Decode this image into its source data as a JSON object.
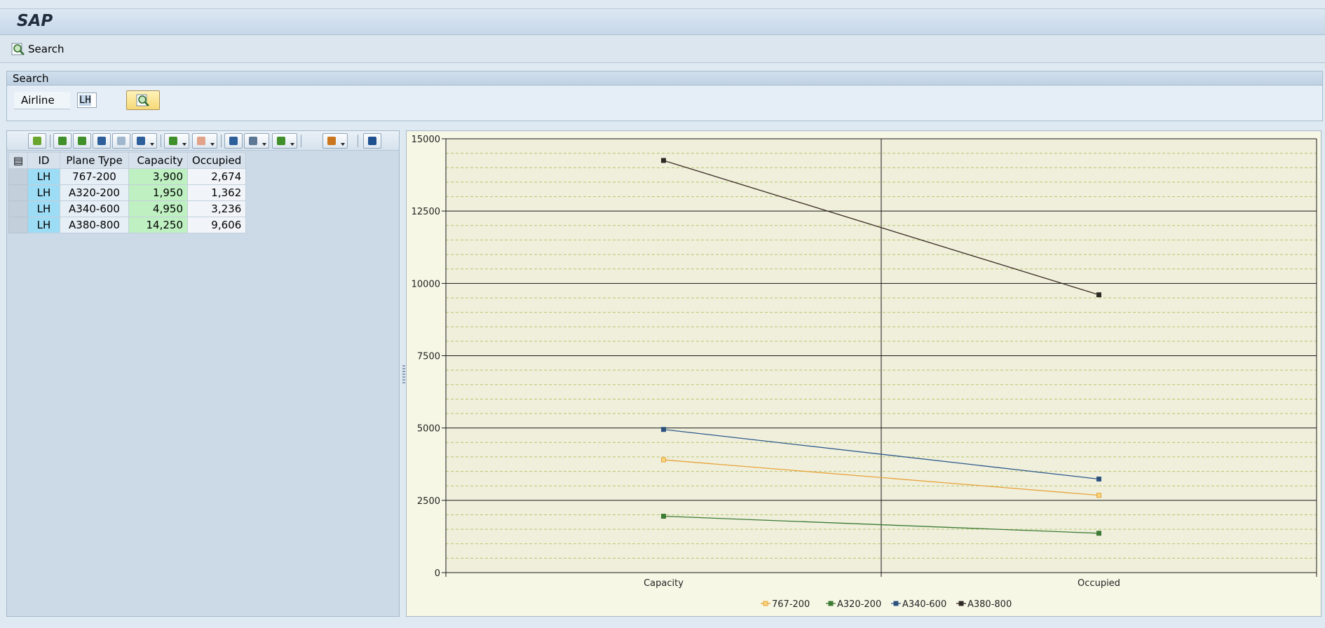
{
  "app": {
    "title": "SAP"
  },
  "toolbar": {
    "search_label": "Search"
  },
  "search_section": {
    "header": "Search",
    "airline_label": "Airline",
    "airline_value": "LH"
  },
  "table": {
    "columns": [
      "ID",
      "Plane Type",
      "Capacity",
      "Occupied"
    ],
    "rows": [
      {
        "id": "LH",
        "plane_type": "767-200",
        "capacity": "3,900",
        "occupied": "2,674"
      },
      {
        "id": "LH",
        "plane_type": "A320-200",
        "capacity": "1,950",
        "occupied": "1,362"
      },
      {
        "id": "LH",
        "plane_type": "A340-600",
        "capacity": "4,950",
        "occupied": "3,236"
      },
      {
        "id": "LH",
        "plane_type": "A380-800",
        "capacity": "14,250",
        "occupied": "9,606"
      }
    ]
  },
  "colors": {
    "series_767": "#e8a33a",
    "series_a320": "#3d7a34",
    "series_a340": "#2f5a8a",
    "series_a380": "#3a2a22",
    "plot_bg": "#efefdc",
    "capacity_cell": "#bff0c2",
    "id_cell": "#9ddcf5"
  },
  "chart_data": {
    "type": "line",
    "categories": [
      "Capacity",
      "Occupied"
    ],
    "series": [
      {
        "name": "767-200",
        "values": [
          3900,
          2674
        ],
        "color": "#e8a33a",
        "marker_fill": "#f6d57c"
      },
      {
        "name": "A320-200",
        "values": [
          1950,
          1362
        ],
        "color": "#3d7a34",
        "marker_fill": "#3d7a34"
      },
      {
        "name": "A340-600",
        "values": [
          4950,
          3236
        ],
        "color": "#2f5a8a",
        "marker_fill": "#2f4f77"
      },
      {
        "name": "A380-800",
        "values": [
          14250,
          9606
        ],
        "color": "#3a2a22",
        "marker_fill": "#2a2a2a"
      }
    ],
    "ylim": [
      0,
      15000
    ],
    "yticks": [
      0,
      2500,
      5000,
      7500,
      10000,
      12500,
      15000
    ],
    "minor_grid_step": 500,
    "grid": true,
    "legend_position": "bottom-center",
    "title": "",
    "xlabel": "",
    "ylabel": ""
  }
}
